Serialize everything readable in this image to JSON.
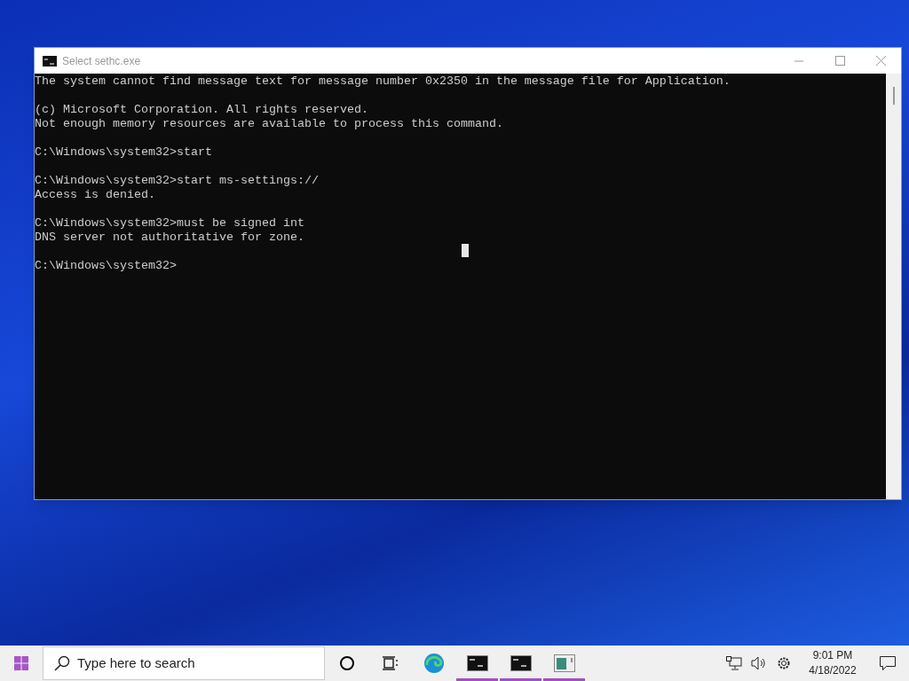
{
  "window": {
    "title": "Select sethc.exe"
  },
  "console": {
    "blocks": [
      [
        "The system cannot find message text for message number 0x2350 in the message file for Application."
      ],
      [
        "(c) Microsoft Corporation. All rights reserved.",
        "Not enough memory resources are available to process this command."
      ],
      [
        "C:\\Windows\\system32>start"
      ],
      [
        "C:\\Windows\\system32>start ms-settings://",
        "Access is denied."
      ],
      [
        "C:\\Windows\\system32>must be signed int",
        "DNS server not authoritative for zone."
      ],
      [
        "C:\\Windows\\system32>"
      ]
    ]
  },
  "taskbar": {
    "search": {
      "placeholder": "Type here to search"
    },
    "apps": [
      {
        "kind": "cortana",
        "open": false
      },
      {
        "kind": "taskview",
        "open": false
      },
      {
        "kind": "edge",
        "open": false
      },
      {
        "kind": "console",
        "open": true
      },
      {
        "kind": "console",
        "open": true
      },
      {
        "kind": "window",
        "open": true
      }
    ],
    "clock": {
      "time": "9:01 PM",
      "date": "4/18/2022"
    }
  }
}
